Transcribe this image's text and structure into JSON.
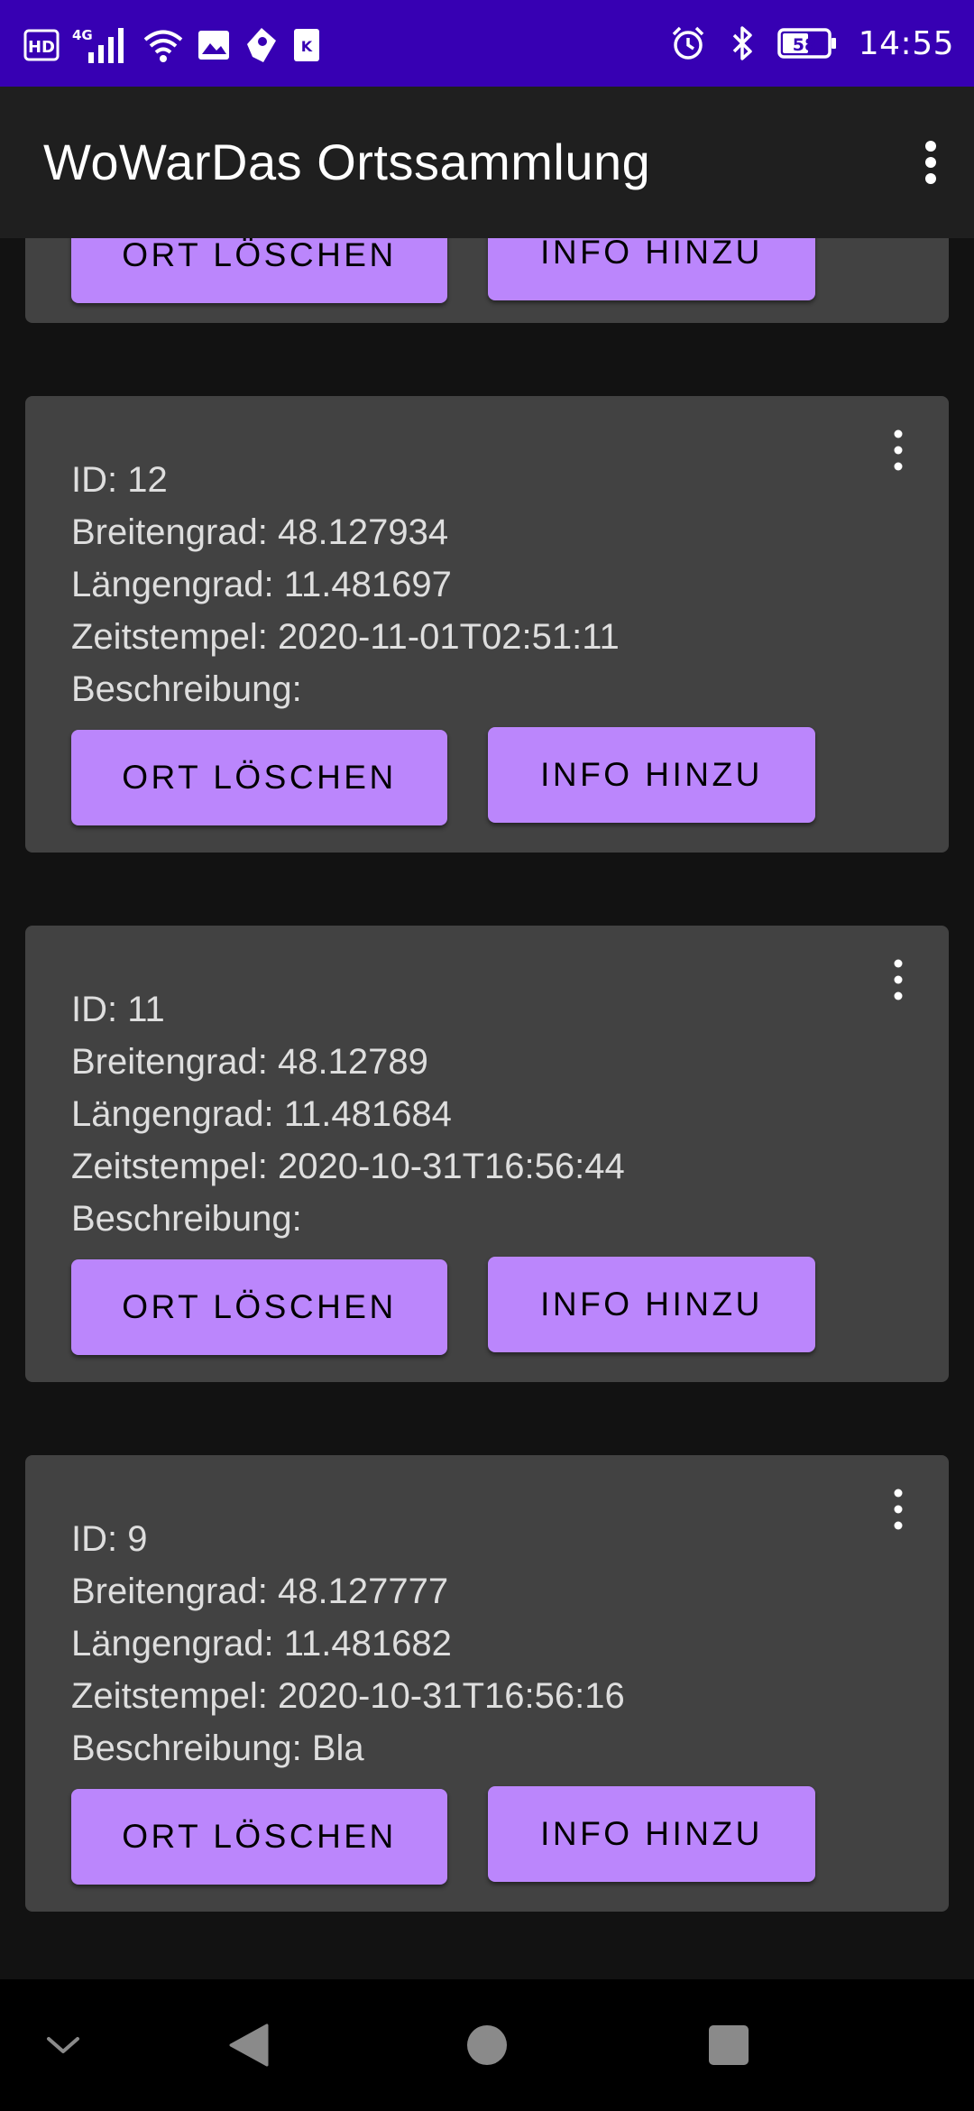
{
  "status_bar": {
    "time": "14:55",
    "battery": "58",
    "network": "4G",
    "hd_label": "HD",
    "left_icons": [
      "hd-icon",
      "signal-icon",
      "wifi-icon",
      "image-icon",
      "pin-icon",
      "kik-icon"
    ],
    "right_icons": [
      "alarm-icon",
      "bluetooth-icon",
      "battery-icon"
    ]
  },
  "app_bar": {
    "title": "WoWarDas Ortssammlung",
    "menu_icon": "more-vert-icon"
  },
  "partial_card": {
    "delete_label": "ORT LÖSCHEN",
    "info_label": "INFO HINZU"
  },
  "cards": [
    {
      "id": "ID: 12",
      "lat": "Breitengrad: 48.127934",
      "lon": "Längengrad: 11.481697",
      "time": "Zeitstempel: 2020-11-01T02:51:11",
      "desc": "Beschreibung:",
      "delete_label": "ORT LÖSCHEN",
      "info_label": "INFO HINZU"
    },
    {
      "id": "ID: 11",
      "lat": "Breitengrad: 48.12789",
      "lon": "Längengrad: 11.481684",
      "time": "Zeitstempel: 2020-10-31T16:56:44",
      "desc": "Beschreibung:",
      "delete_label": "ORT LÖSCHEN",
      "info_label": "INFO HINZU"
    },
    {
      "id": "ID: 9",
      "lat": "Breitengrad: 48.127777",
      "lon": "Längengrad: 11.481682",
      "time": "Zeitstempel: 2020-10-31T16:56:16",
      "desc": "Beschreibung: Bla",
      "delete_label": "ORT LÖSCHEN",
      "info_label": "INFO HINZU"
    }
  ],
  "nav_bar": {
    "icons": [
      "collapse-icon",
      "back-icon",
      "home-icon",
      "recents-icon"
    ]
  },
  "colors": {
    "status_bar": "#3700b3",
    "app_bar": "#1f1f1f",
    "background": "#121212",
    "card": "#424242",
    "button": "#bb86fc",
    "button_text": "#000000"
  }
}
